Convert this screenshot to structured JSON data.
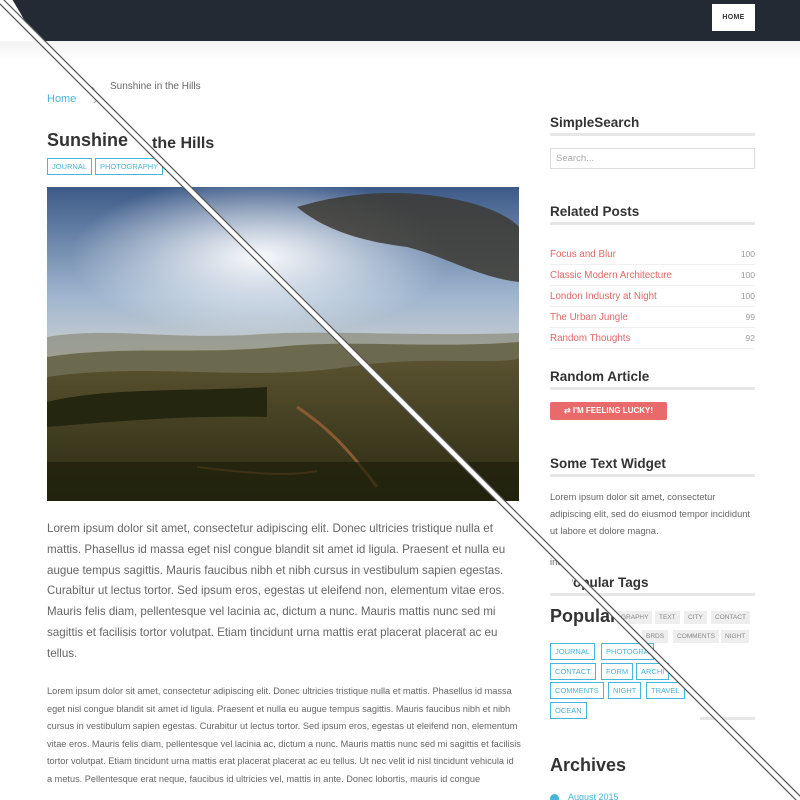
{
  "nav": {
    "home_label": "HOME"
  },
  "breadcrumb": {
    "home": "Home",
    "separator": "›",
    "current": "Sunshine in the Hills"
  },
  "post": {
    "title": "Sunshine in the Hills",
    "title_fragment_front": "Sunshine",
    "title_fragment_back": "the Hills",
    "tags": [
      "JOURNAL",
      "PHOTOGRAPHY"
    ],
    "paragraph_large": "Lorem ipsum dolor sit amet, consectetur adipiscing elit. Donec ultricies tristique nulla et mattis. Phasellus id massa eget nisl congue blandit sit amet id ligula. Praesent et nulla eu augue tempus sagittis. Mauris faucibus nibh et nibh cursus in vestibulum sapien egestas. Curabitur ut lectus tortor. Sed ipsum eros, egestas ut eleifend non, elementum vitae eros. Mauris felis diam, pellentesque vel lacinia ac, dictum a nunc. Mauris mattis nunc sed mi sagittis et facilisis tortor volutpat. Etiam tincidunt urna mattis erat placerat placerat ac eu tellus.",
    "paragraph_small": "Lorem ipsum dolor sit amet, consectetur adipiscing elit. Donec ultricies tristique nulla et mattis. Phasellus id massa eget nisl congue blandit sit amet id ligula. Praesent et nulla eu augue tempus sagittis. Mauris faucibus nibh et nibh cursus in vestibulum sapien egestas. Curabitur ut lectus tortor. Sed ipsum eros, egestas ut eleifend non, elementum vitae eros. Mauris felis diam, pellentesque vel lacinia ac, dictum a nunc. Mauris mattis nunc sed mi sagittis et facilisis tortor volutpat. Etiam tincidunt urna mattis erat placerat placerat ac eu tellus. Ut nec velit id nisl tincidunt vehicula id a metus. Pellentesque erat neque, faucibus id ultricies vel, mattis in ante. Donec lobortis, mauris id congue"
  },
  "sidebar": {
    "search": {
      "title": "SimpleSearch",
      "placeholder": "Search..."
    },
    "related": {
      "title": "Related Posts",
      "items": [
        {
          "label": "Focus and Blur",
          "count": "100"
        },
        {
          "label": "Classic Modern Architecture",
          "count": "100"
        },
        {
          "label": "London Industry at Night",
          "count": "100"
        },
        {
          "label": "The Urban Jungle",
          "count": "99"
        },
        {
          "label": "Random Thoughts",
          "count": "92"
        }
      ]
    },
    "random": {
      "title": "Random Article",
      "button_label": "I'M FEELING LUCKY!"
    },
    "text_widget": {
      "title": "Some Text Widget",
      "body": "Lorem ipsum dolor sit amet, consectetur adipiscing elit, sed do eiusmod tempor incididunt ut labore et dolore magna.",
      "fragment": "inc"
    },
    "popular": {
      "title": "Popular Tags",
      "fragment_title": "Popular Tags",
      "big_title": "Popular",
      "gray_tags": [
        "GRAPHY",
        "TEXT",
        "CITY",
        "CONTACT",
        "BRDS",
        "COMMENTS",
        "NIGHT"
      ],
      "blue_tags": [
        "JOURNAL",
        "PHOTOGRA",
        "CONTACT",
        "FORM",
        "ARCHI",
        "COMMENTS",
        "NIGHT",
        "TRAVEL",
        "OCEAN"
      ]
    },
    "archives": {
      "title": "Archives",
      "first_item": "August 2015"
    }
  },
  "colors": {
    "accent_blue": "#46b6dc",
    "accent_red": "#e36767",
    "topbar": "#232a33"
  }
}
